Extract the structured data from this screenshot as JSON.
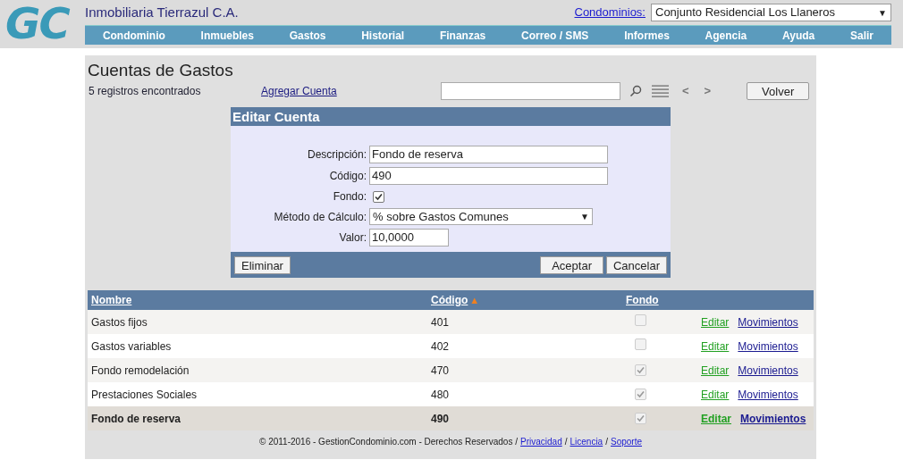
{
  "header": {
    "logo": "GC",
    "company": "Inmobiliaria Tierrazul C.A.",
    "condominios_label": "Condominios:",
    "condominio_select": "Conjunto Residencial Los Llaneros",
    "select_arrow": "▼"
  },
  "nav": [
    "Condominio",
    "Inmuebles",
    "Gastos",
    "Historial",
    "Finanzas",
    "Correo / SMS",
    "Informes",
    "Agencia",
    "Ayuda",
    "Salir"
  ],
  "page": {
    "title": "Cuentas de Gastos",
    "count": "5 registros encontrados",
    "add_link": "Agregar Cuenta",
    "prev": "<",
    "next": ">",
    "back_button": "Volver"
  },
  "edit_panel": {
    "title": "Editar Cuenta",
    "fields": [
      {
        "kind": "text",
        "label": "Descripción:",
        "value": "Fondo de reserva"
      },
      {
        "kind": "text",
        "label": "Código:",
        "value": "490"
      },
      {
        "kind": "checkbox",
        "label": "Fondo:",
        "checked": true
      },
      {
        "kind": "select",
        "label": "Método de Cálculo:",
        "value": "% sobre Gastos Comunes",
        "arrow": "▼"
      },
      {
        "kind": "short",
        "label": "Valor:",
        "value": "10,0000"
      }
    ],
    "delete_button": "Eliminar",
    "accept_button": "Aceptar",
    "cancel_button": "Cancelar"
  },
  "table": {
    "columns": [
      "Nombre",
      "Código",
      "Fondo"
    ],
    "sort_mark": "▲",
    "rows": [
      {
        "name": "Gastos fijos",
        "code": "401",
        "fondo": false,
        "edit": "Editar",
        "movements": "Movimientos",
        "selected": false
      },
      {
        "name": "Gastos variables",
        "code": "402",
        "fondo": false,
        "edit": "Editar",
        "movements": "Movimientos",
        "selected": false
      },
      {
        "name": "Fondo remodelación",
        "code": "470",
        "fondo": true,
        "edit": "Editar",
        "movements": "Movimientos",
        "selected": false
      },
      {
        "name": "Prestaciones Sociales",
        "code": "480",
        "fondo": true,
        "edit": "Editar",
        "movements": "Movimientos",
        "selected": false
      },
      {
        "name": "Fondo de reserva",
        "code": "490",
        "fondo": true,
        "edit": "Editar",
        "movements": "Movimientos",
        "selected": true
      }
    ]
  },
  "footer": {
    "text": "© 2011-2016 - GestionCondominio.com - Derechos Reservados /",
    "links": [
      "Privacidad",
      "Licencia",
      "Soporte"
    ],
    "separator": "/"
  }
}
